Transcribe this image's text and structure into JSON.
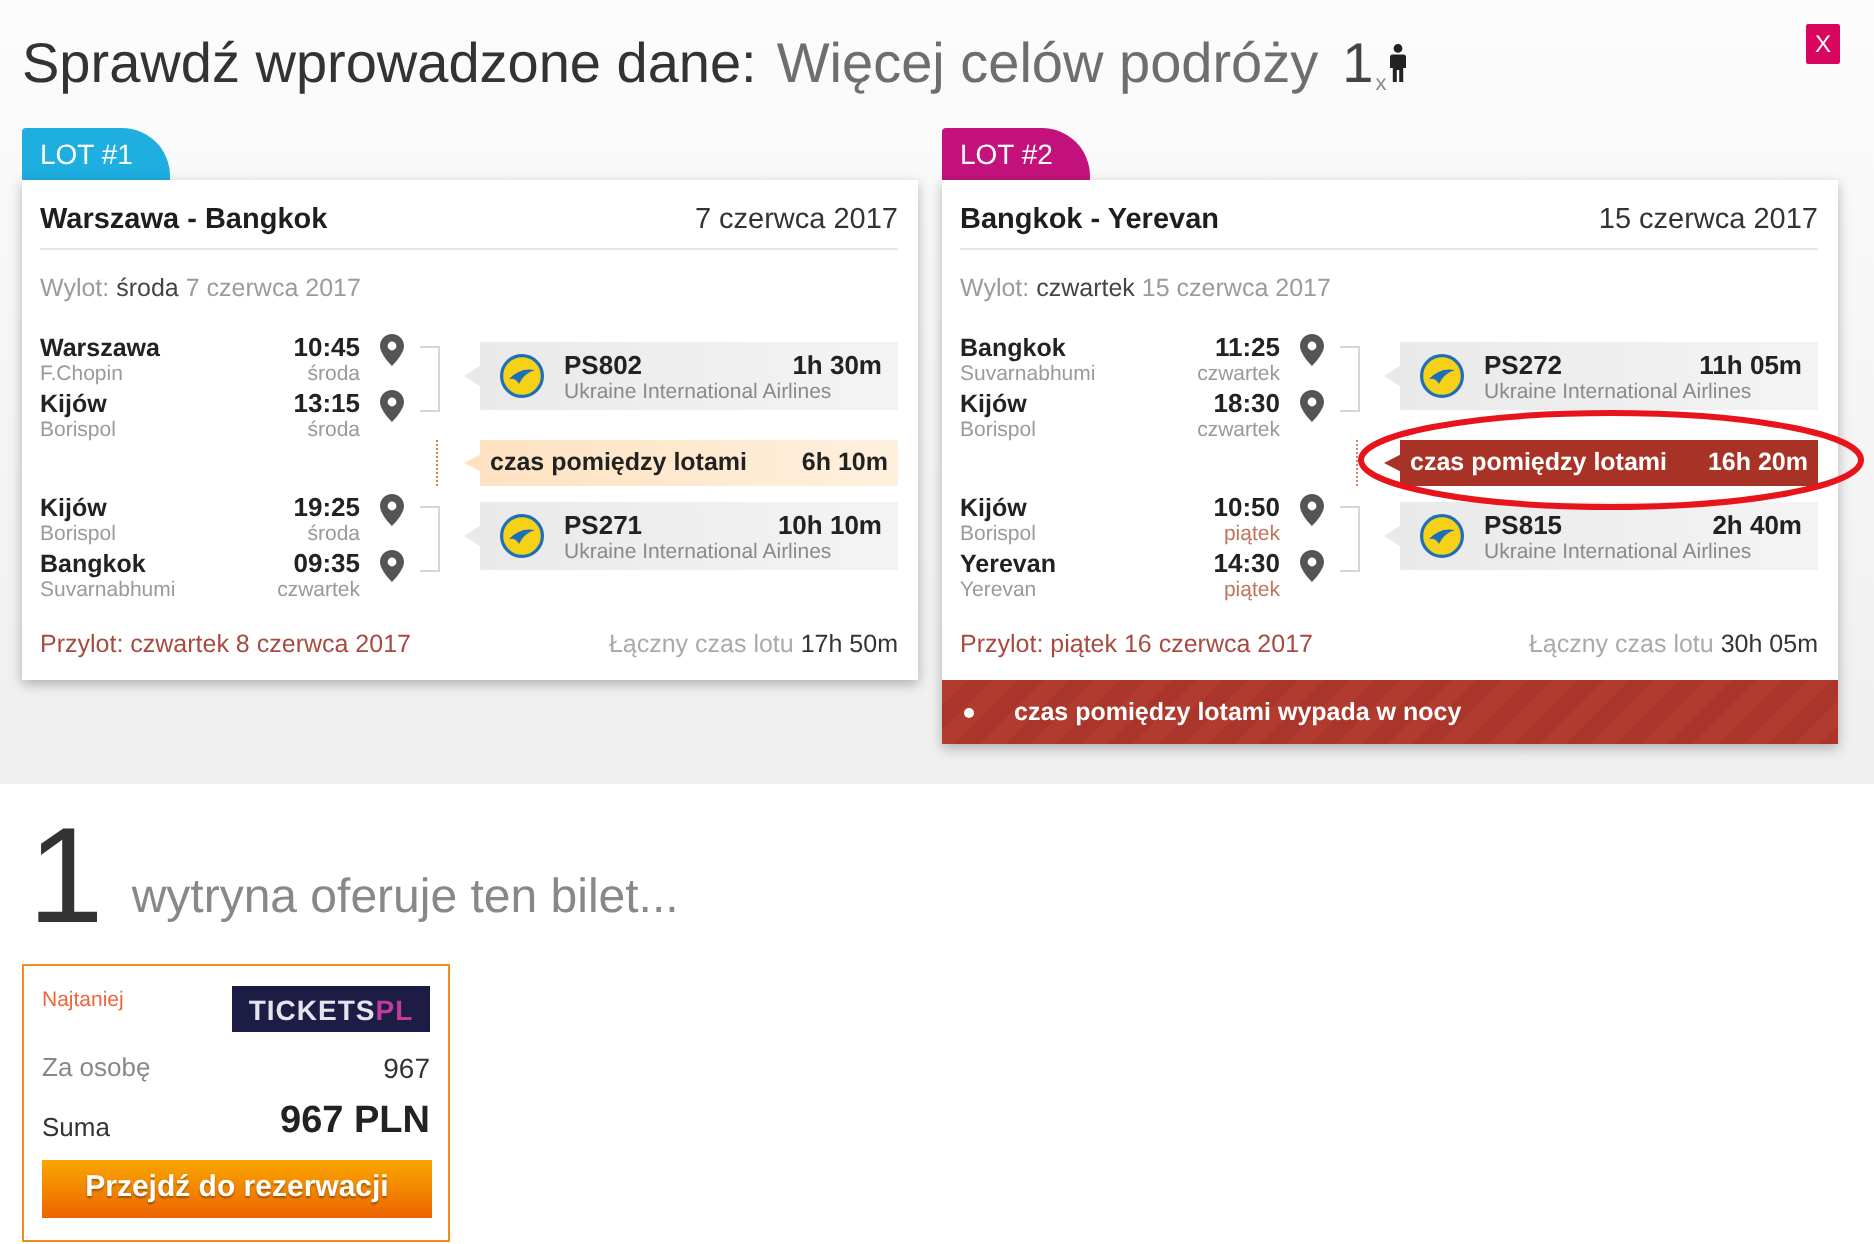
{
  "header": {
    "title": "Sprawdź wprowadzone dane:",
    "subtitle": "Więcej celów podróży",
    "passenger_count": "1",
    "passenger_suffix": "x",
    "close": "X"
  },
  "flights": [
    {
      "tab": "LOT #1",
      "color": "#1eaee0",
      "route": "Warszawa - Bangkok",
      "date": "7 czerwca 2017",
      "departure": {
        "label": "Wylot:",
        "weekday": "środa",
        "date": "7 czerwca 2017"
      },
      "segments": [
        {
          "kind": "flight",
          "stops": [
            {
              "city": "Warszawa",
              "airport": "F.Chopin",
              "time": "10:45",
              "day": "środa",
              "day_highlighted": false
            },
            {
              "city": "Kijów",
              "airport": "Borispol",
              "time": "13:15",
              "day": "środa",
              "day_highlighted": false
            }
          ],
          "number": "PS802",
          "duration": "1h 30m",
          "airline": "Ukraine International Airlines"
        },
        {
          "kind": "layover",
          "label": "czas pomiędzy lotami",
          "duration": "6h 10m",
          "alert": false,
          "highlighted": false
        },
        {
          "kind": "flight",
          "stops": [
            {
              "city": "Kijów",
              "airport": "Borispol",
              "time": "19:25",
              "day": "środa",
              "day_highlighted": false
            },
            {
              "city": "Bangkok",
              "airport": "Suvarnabhumi",
              "time": "09:35",
              "day": "czwartek",
              "day_highlighted": false
            }
          ],
          "number": "PS271",
          "duration": "10h 10m",
          "airline": "Ukraine International Airlines"
        }
      ],
      "arrival": "Przylot: czwartek 8 czerwca 2017",
      "total": {
        "label": "Łączny czas lotu",
        "value": "17h 50m"
      }
    },
    {
      "tab": "LOT #2",
      "color": "#c4127c",
      "route": "Bangkok - Yerevan",
      "date": "15 czerwca 2017",
      "departure": {
        "label": "Wylot:",
        "weekday": "czwartek",
        "date": "15 czerwca 2017"
      },
      "segments": [
        {
          "kind": "flight",
          "stops": [
            {
              "city": "Bangkok",
              "airport": "Suvarnabhumi",
              "time": "11:25",
              "day": "czwartek",
              "day_highlighted": false
            },
            {
              "city": "Kijów",
              "airport": "Borispol",
              "time": "18:30",
              "day": "czwartek",
              "day_highlighted": false
            }
          ],
          "number": "PS272",
          "duration": "11h 05m",
          "airline": "Ukraine International Airlines"
        },
        {
          "kind": "layover",
          "label": "czas pomiędzy lotami",
          "duration": "16h 20m",
          "alert": true,
          "highlighted": true
        },
        {
          "kind": "flight",
          "stops": [
            {
              "city": "Kijów",
              "airport": "Borispol",
              "time": "10:50",
              "day": "piątek",
              "day_highlighted": true
            },
            {
              "city": "Yerevan",
              "airport": "Yerevan",
              "time": "14:30",
              "day": "piątek",
              "day_highlighted": true
            }
          ],
          "number": "PS815",
          "duration": "2h 40m",
          "airline": "Ukraine International Airlines"
        }
      ],
      "arrival": "Przylot: piątek 16 czerwca 2017",
      "total": {
        "label": "Łączny czas lotu",
        "value": "30h 05m"
      },
      "warnings": [
        "czas pomiędzy lotami wypada w nocy"
      ]
    }
  ],
  "offers_section": {
    "count": "1",
    "heading": "wytryna oferuje ten bilet...",
    "offers": [
      {
        "badge": "Najtaniej",
        "logo": {
          "text": "TICKETS",
          "accent": "PL"
        },
        "per_person_label": "Za osobę",
        "per_person": "967",
        "total_label": "Suma",
        "total": "967 PLN",
        "button": "Przejdź do rezerwacji"
      }
    ]
  }
}
